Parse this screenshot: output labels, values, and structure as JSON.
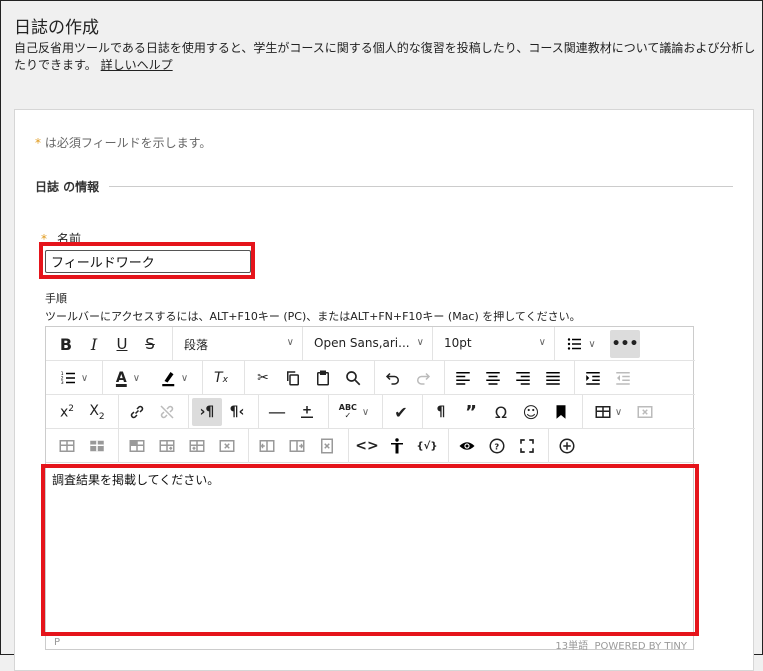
{
  "page": {
    "title": "日誌の作成",
    "description": "自己反省用ツールである日誌を使用すると、学生がコースに関する個人的な復習を投稿したり、コース関連教材について議論および分析したりできます。",
    "help_link": "詳しいヘルプ"
  },
  "form": {
    "required_star": "*",
    "required_note": "は必須フィールドを示します。",
    "section_title": "日誌 の情報",
    "name_label": "名前",
    "name_value": "フィールドワーク",
    "instructions_label": "手順",
    "toolbar_hint": "ツールバーにアクセスするには、ALT+F10キー (PC)、またはALT+FN+F10キー (Mac) を押してください。"
  },
  "editor": {
    "block_format": "段落",
    "font_family": "Open Sans,ari...",
    "font_size": "10pt",
    "content": "調査結果を掲載してください。",
    "status_path": "P",
    "word_count": "13単語",
    "powered_by": "POWERED BY TINY"
  },
  "colors": {
    "highlight": "#e5141b",
    "required": "#e19a1c"
  }
}
